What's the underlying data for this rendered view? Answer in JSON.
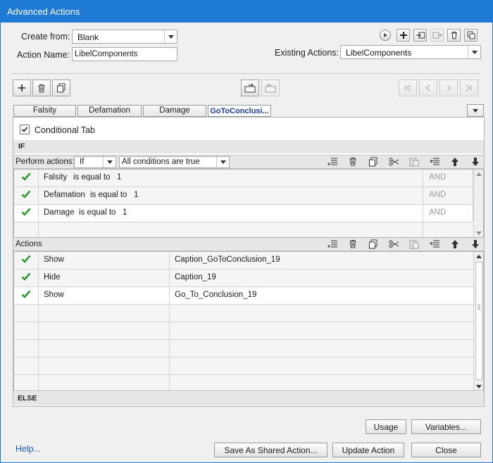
{
  "window": {
    "title": "Advanced Actions"
  },
  "form": {
    "create_from_label": "Create from:",
    "create_from_value": "Blank",
    "action_name_label": "Action Name:",
    "action_name_value": "LibelComponents",
    "existing_actions_label": "Existing Actions:",
    "existing_actions_value": "LibelComponents"
  },
  "tabs": [
    {
      "label": "Falsity"
    },
    {
      "label": "Defamation"
    },
    {
      "label": "Damage"
    },
    {
      "label": "GoToConclusi..."
    }
  ],
  "conditional": {
    "checkbox_label": "Conditional Tab",
    "checked": true
  },
  "if_section": {
    "header": "IF",
    "perform_label": "Perform actions:",
    "perform_value": "If",
    "conditions_value": "All conditions are true",
    "rows": [
      {
        "variable": "Falsity",
        "operator": "is equal to",
        "value": "1",
        "logic": "AND"
      },
      {
        "variable": "Defamation",
        "operator": "is equal to",
        "value": "1",
        "logic": "AND"
      },
      {
        "variable": "Damage",
        "operator": "is equal to",
        "value": "1",
        "logic": "AND"
      }
    ]
  },
  "actions_section": {
    "header": "Actions",
    "rows": [
      {
        "action": "Show",
        "target": "Caption_GoToConclusion_19"
      },
      {
        "action": "Hide",
        "target": "Caption_19"
      },
      {
        "action": "Show",
        "target": "Go_To_Conclusion_19"
      }
    ]
  },
  "else_section": {
    "header": "ELSE"
  },
  "footer": {
    "help": "Help...",
    "usage": "Usage",
    "variables": "Variables...",
    "save_shared": "Save As Shared Action...",
    "update": "Update Action",
    "close": "Close"
  },
  "colors": {
    "titlebar": "#1f7ad6",
    "check": "#2e9a2e",
    "active_tab_text": "#1a3aa8",
    "link": "#1a5bbf"
  },
  "icons": [
    "play-icon",
    "add-icon",
    "import-icon",
    "export-icon",
    "delete-icon",
    "duplicate-icon",
    "trash-icon",
    "copy-icon",
    "cut-icon",
    "paste-icon",
    "insert-icon",
    "arrow-up-icon",
    "arrow-down-icon",
    "first-icon",
    "prev-icon",
    "next-icon",
    "last-icon",
    "checkmark-icon"
  ]
}
